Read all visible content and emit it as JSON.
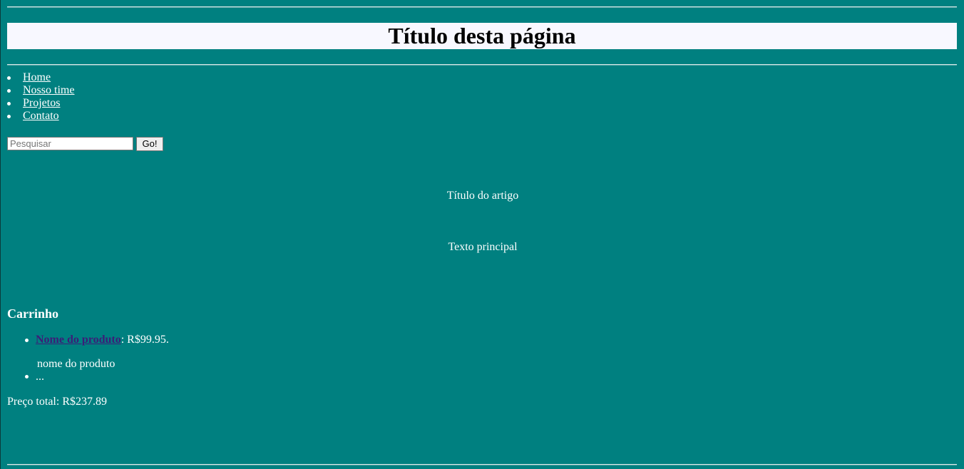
{
  "page": {
    "title": "Título desta página"
  },
  "nav": {
    "items": [
      {
        "label": "Home"
      },
      {
        "label": "Nosso time"
      },
      {
        "label": "Projetos"
      },
      {
        "label": "Contato"
      }
    ]
  },
  "search": {
    "placeholder": "Pesquisar",
    "button_label": "Go!"
  },
  "article": {
    "title": "Título do artigo",
    "body": "Texto principal"
  },
  "cart": {
    "heading": "Carrinho",
    "items": [
      {
        "product_name": "Nome do produto",
        "price_suffix": ": R$99.95.",
        "image_alt": "nome do produto"
      },
      {
        "text": "..."
      }
    ],
    "total": "Preço total: R$237.89"
  },
  "colors": {
    "background": "#008080",
    "title_bar": "#f8f8ff",
    "product_link": "#3b1d78"
  }
}
